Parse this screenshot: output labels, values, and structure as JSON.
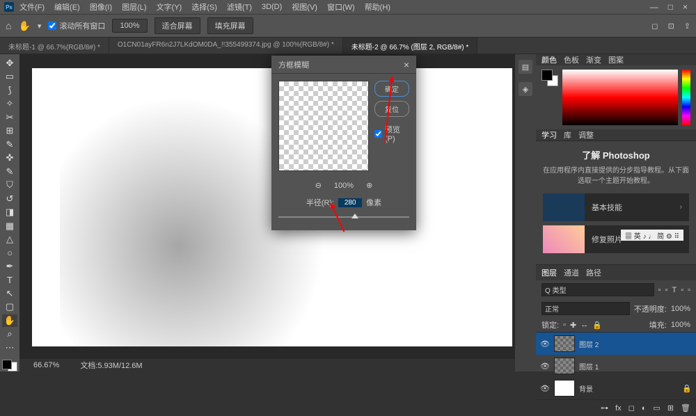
{
  "menu": {
    "items": [
      "文件(F)",
      "编辑(E)",
      "图像(I)",
      "图层(L)",
      "文字(Y)",
      "选择(S)",
      "滤镜(T)",
      "3D(D)",
      "视图(V)",
      "窗口(W)",
      "帮助(H)"
    ]
  },
  "window": {
    "min": "—",
    "max": "□",
    "close": "×"
  },
  "optbar": {
    "scroll": "滚动所有窗口",
    "actual": "100%",
    "fit": "适合屏幕",
    "fill": "填充屏幕"
  },
  "tabs": [
    {
      "label": "未标题-1 @ 66.7%(RGB/8#) *"
    },
    {
      "label": "O1CN01ayFR6n2J7LKdOM0DA_!!355499374.jpg @ 100%(RGB/8#) *"
    },
    {
      "label": "未标题-2 @ 66.7% (图层 2, RGB/8#) *"
    }
  ],
  "dialog": {
    "title": "方框模糊",
    "ok": "确定",
    "cancel": "复位",
    "preview": "预览(P)",
    "zoom": "100%",
    "radiusLabel": "半径(R):",
    "radiusVal": "280",
    "radiusUnit": "像素"
  },
  "status": {
    "zoom": "66.67%",
    "doc": "文档:5.93M/12.6M"
  },
  "colorTabs": [
    "颜色",
    "色板",
    "渐变",
    "图案"
  ],
  "learnTabs": [
    "学习",
    "库",
    "调整"
  ],
  "learn": {
    "title": "了解 Photoshop",
    "desc": "在应用程序内直接提供的分步指导教程。从下面选取一个主题开始教程。",
    "card1": "基本技能",
    "card2": "修复照片"
  },
  "layerTabs": [
    "图层",
    "通道",
    "路径"
  ],
  "layerOpts": {
    "kind": "Q 类型",
    "opacity": "不透明度:",
    "opacityVal": "100%",
    "lock": "锁定:",
    "fill": "填充:",
    "fillVal": "100%",
    "blend": "正常"
  },
  "layers": [
    {
      "name": "图层 2"
    },
    {
      "name": "图层 1"
    },
    {
      "name": "背景"
    }
  ],
  "ime": "▦ 英 ♪ ♩ 简 ⚙ ⠿"
}
